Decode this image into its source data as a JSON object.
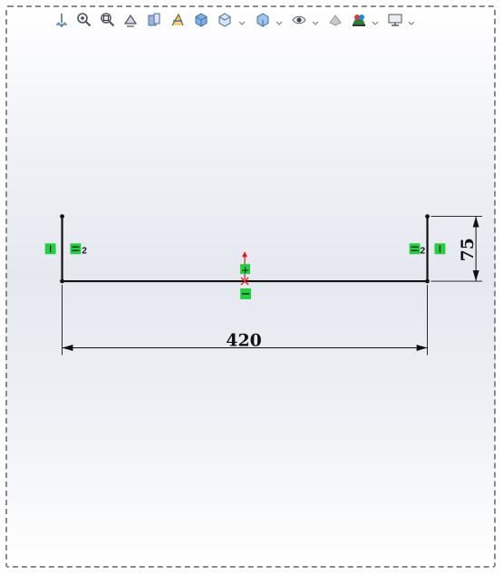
{
  "toolbar": {
    "icons": [
      "view-orientation-icon",
      "zoom-to-fit-icon",
      "zoom-area-icon",
      "previous-view-icon",
      "section-view-icon",
      "dynamic-annotation-icon",
      "view-cube-icon",
      "display-style-icon",
      "hide-show-items-icon",
      "edit-appearance-icon",
      "apply-scene-icon",
      "view-settings-icon"
    ]
  },
  "sketch": {
    "horizontal_dimension": "420",
    "vertical_dimension": "75",
    "equal_relation_index_left": "2",
    "equal_relation_index_right": "2"
  },
  "colors": {
    "relation_badge": "#1fd13a",
    "origin_arrow": "#e8121b",
    "sketch_line": "#111111"
  }
}
